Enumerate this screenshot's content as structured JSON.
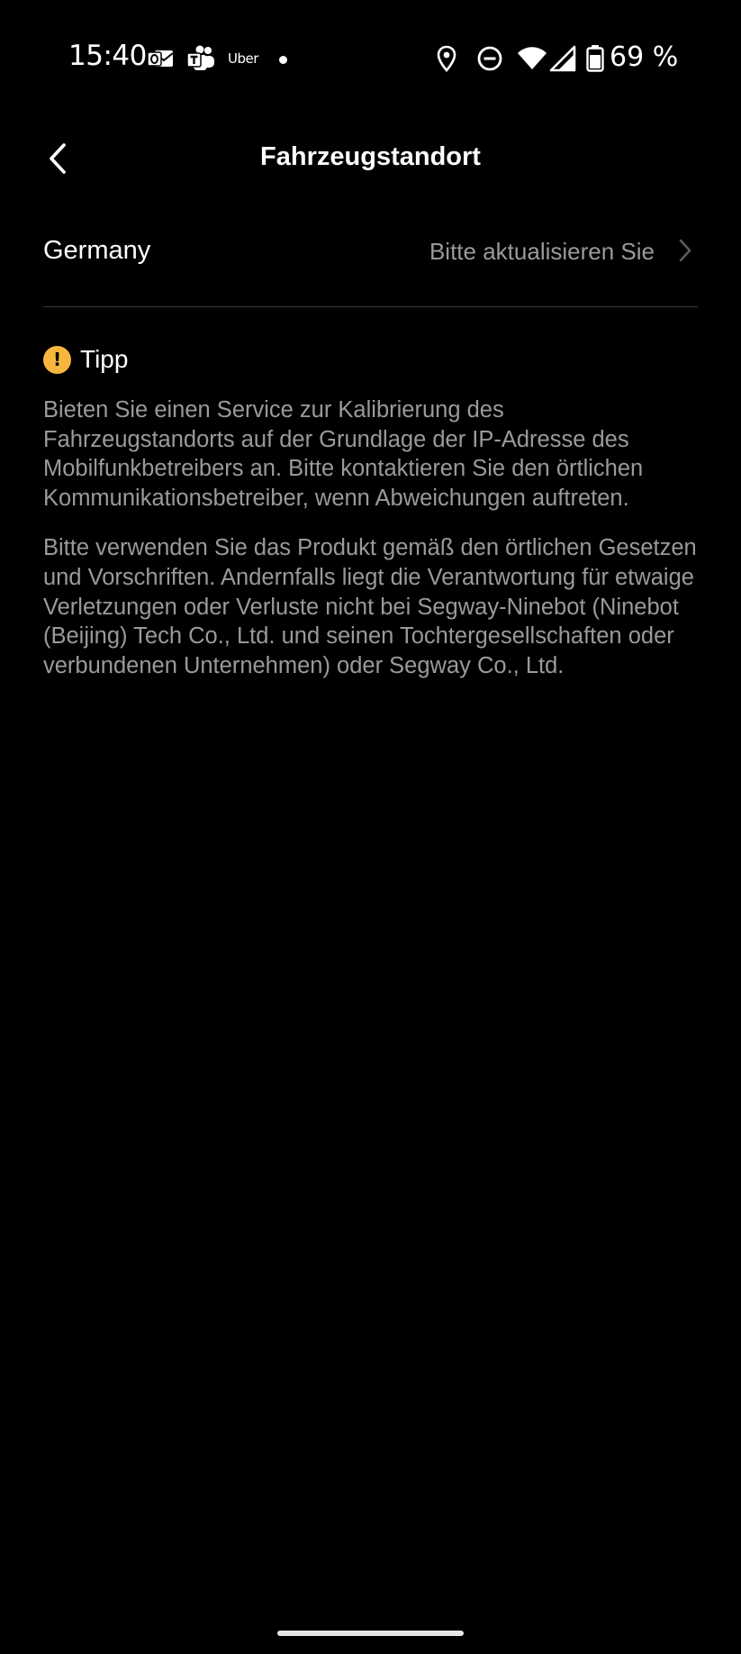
{
  "status_bar": {
    "time": "15:40",
    "notifications": [
      "outlook-icon",
      "teams-icon",
      "uber-icon",
      "more-notifications-dot"
    ],
    "uber_label": "Uber",
    "indicators": [
      "location-icon",
      "do-not-disturb-icon",
      "wifi-icon",
      "cellular-signal-icon",
      "battery-icon"
    ],
    "battery_percent": "69 %"
  },
  "header": {
    "back_icon": "chevron-left-icon",
    "title": "Fahrzeugstandort"
  },
  "region": {
    "name": "Germany",
    "status": "Bitte aktualisieren Sie",
    "chevron_icon": "chevron-right-icon"
  },
  "tip": {
    "icon": "warning-icon",
    "icon_glyph": "!",
    "title": "Tipp",
    "paragraphs": [
      "Bieten Sie einen Service zur Kalibrierung des Fahrzeugstandorts auf der Grundlage der IP-Adresse des Mobilfunkbetreibers an. Bitte kontaktieren Sie den örtlichen Kommunikationsbetreiber, wenn Abweichungen auftreten.",
      "Bitte verwenden Sie das Produkt gemäß den örtlichen Gesetzen und Vorschriften. Andernfalls liegt die Verantwortung für etwaige Verletzungen oder Verluste nicht bei Segway-Ninebot (Ninebot (Beijing) Tech Co., Ltd. und seinen Tochtergesellschaften oder verbundenen Unternehmen) oder Segway Co., Ltd."
    ]
  },
  "colors": {
    "background": "#000000",
    "text_primary": "#ffffff",
    "text_secondary": "#9a9a9a",
    "tip_accent": "#f6b73c",
    "divider": "#3a3a3a"
  }
}
